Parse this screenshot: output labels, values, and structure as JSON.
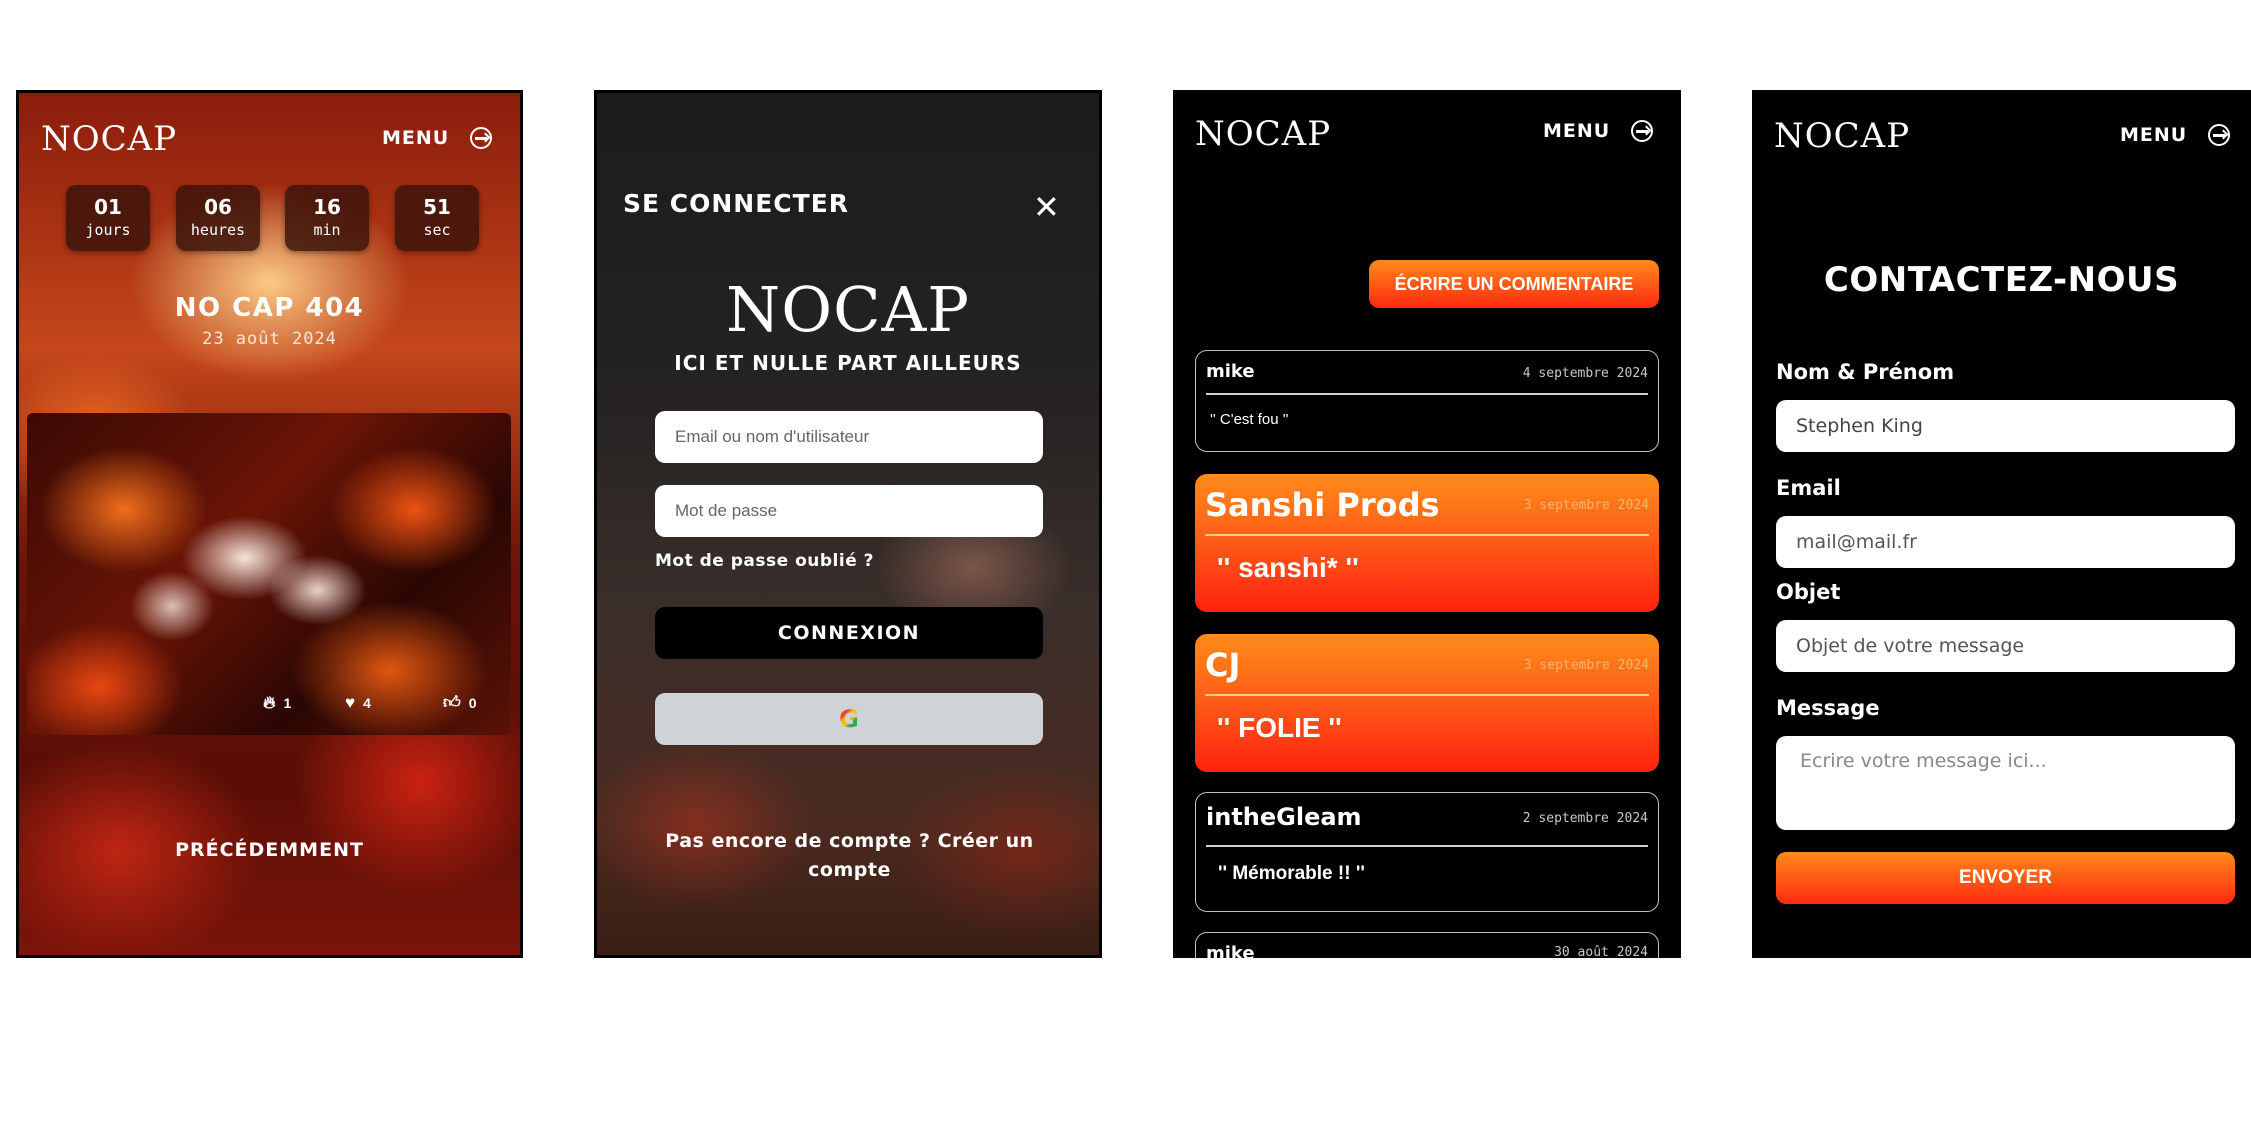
{
  "brand": {
    "logo": "NOCAP",
    "menu": "MENU"
  },
  "home": {
    "countdown": [
      {
        "value": "01",
        "unit": "jours"
      },
      {
        "value": "06",
        "unit": "heures"
      },
      {
        "value": "16",
        "unit": "min"
      },
      {
        "value": "51",
        "unit": "sec"
      }
    ],
    "event_title": "NO CAP 404",
    "event_date": "23 août 2024",
    "stats": {
      "fire": "1",
      "heart": "4",
      "like": "0"
    },
    "previous": "PRÉCÉDEMMENT"
  },
  "login": {
    "title": "SE CONNECTER",
    "close": "✕",
    "tagline": "ICI ET NULLE PART AILLEURS",
    "email_placeholder": "Email ou nom d'utilisateur",
    "password_placeholder": "Mot de passe",
    "forgot": "Mot de passe oublié ?",
    "connect": "CONNEXION",
    "google": "G",
    "signup": "Pas encore de compte ? Créer un compte"
  },
  "comments": {
    "write_button": "ÉCRIRE UN COMMENTAIRE",
    "items": [
      {
        "author": "mike",
        "date": "4 septembre 2024",
        "text": "'' C'est fou ''"
      },
      {
        "author": "Sanshi Prods",
        "date": "3 septembre 2024",
        "text": "'' sanshi* ''"
      },
      {
        "author": "CJ",
        "date": "3 septembre 2024",
        "text": "'' FOLIE ''"
      },
      {
        "author": "intheGleam",
        "date": "2 septembre 2024",
        "text": "'' Mémorable !! ''"
      },
      {
        "author": "mike",
        "date": "30 août 2024",
        "text": ""
      }
    ]
  },
  "contact": {
    "title": "CONTACTEZ-NOUS",
    "name_label": "Nom & Prénom",
    "name_value": "Stephen King",
    "email_label": "Email",
    "email_placeholder": "mail@mail.fr",
    "subject_label": "Objet",
    "subject_placeholder": "Objet de votre message",
    "message_label": "Message",
    "message_placeholder": "Ecrire votre message ici...",
    "send": "ENVOYER"
  },
  "colors": {
    "accent_top": "#ff8a1c",
    "accent_bottom": "#ff2a10"
  }
}
